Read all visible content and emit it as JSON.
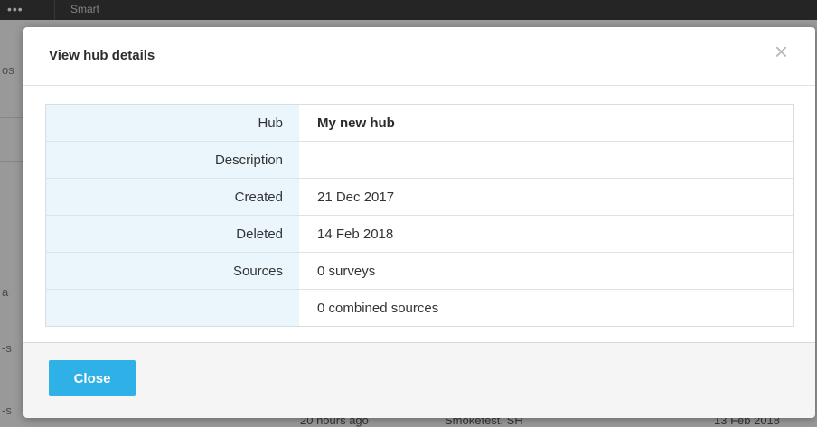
{
  "background": {
    "topbar_menu_glyph": "•••",
    "topbar_tab_label": "Smart",
    "left_fragments": [
      "os",
      "a",
      "-s",
      "-s"
    ],
    "bottom_row": {
      "time": "20 hours ago",
      "owner": "Smoketest, SH",
      "date": "13 Feb 2018"
    }
  },
  "modal": {
    "title": "View hub details",
    "close_glyph": "×",
    "rows": [
      {
        "label": "Hub",
        "value": "My new hub"
      },
      {
        "label": "Description",
        "value": ""
      },
      {
        "label": "Created",
        "value": "21 Dec 2017"
      },
      {
        "label": "Deleted",
        "value": "14 Feb 2018"
      },
      {
        "label": "Sources",
        "value": "0 surveys"
      },
      {
        "label": "",
        "value": "0 combined sources"
      }
    ],
    "close_button_label": "Close"
  },
  "colors": {
    "primary_button": "#2fb0e6",
    "label_cell_bg": "#eaf5fc"
  }
}
